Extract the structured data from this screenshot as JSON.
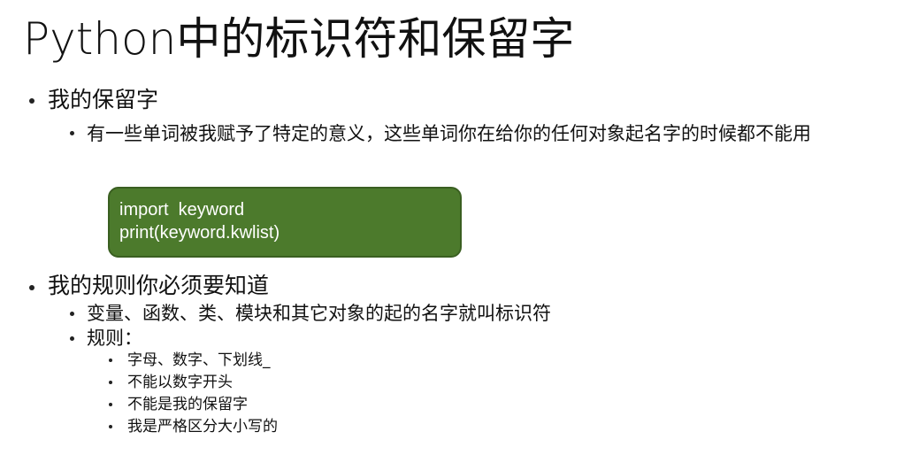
{
  "slide": {
    "title": "Python中的标识符和保留字",
    "sections": [
      {
        "heading": "我的保留字",
        "description": "有一些单词被我赋予了特定的意义，这些单词你在给你的任何对象起名字的时候都不能用",
        "code_lines": [
          "import  keyword",
          "print(keyword.kwlist)"
        ]
      },
      {
        "heading": "我的规则你必须要知道",
        "points": [
          "变量、函数、类、模块和其它对象的起的名字就叫标识符",
          "规则："
        ],
        "rules": [
          "字母、数字、下划线_",
          "不能以数字开头",
          "不能是我的保留字",
          "我是严格区分大小写的"
        ]
      }
    ]
  },
  "colors": {
    "code_background": "#4c7a2c",
    "code_text": "#ffffff",
    "text": "#111111"
  }
}
